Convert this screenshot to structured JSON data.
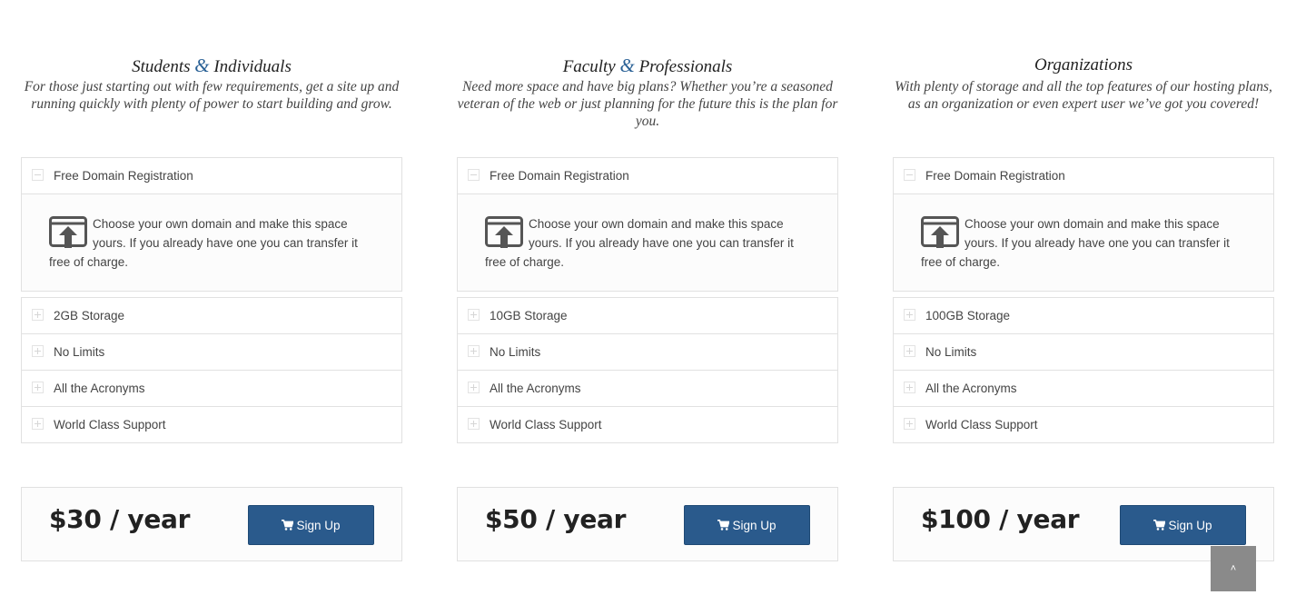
{
  "plans": [
    {
      "title_a": "Students",
      "amp": "&",
      "title_b": "Individuals",
      "description": "For those just starting out with few requirements, get a site up and running quickly with plenty of power to start building and grow.",
      "domain_feature": {
        "label": "Free Domain Registration",
        "body": "Choose your own domain and make this space yours. If you already have one you can transfer it free of charge.",
        "icon": "upload-window-icon"
      },
      "features": [
        "2GB Storage",
        "No Limits",
        "All the Acronyms",
        "World Class Support"
      ],
      "price": "$30 / year",
      "signup_label": "Sign Up"
    },
    {
      "title_a": "Faculty",
      "amp": "&",
      "title_b": "Professionals",
      "description": "Need more space and have big plans? Whether you’re a seasoned veteran of the web or just planning for the future this is the plan for you.",
      "domain_feature": {
        "label": "Free Domain Registration",
        "body": "Choose your own domain and make this space yours. If you already have one you can transfer it free of charge.",
        "icon": "upload-window-icon"
      },
      "features": [
        "10GB Storage",
        "No Limits",
        "All the Acronyms",
        "World Class Support"
      ],
      "price": "$50 / year",
      "signup_label": "Sign Up"
    },
    {
      "title_a": "Organizations",
      "amp": "",
      "title_b": "",
      "description": "With plenty of storage and all the top features of our hosting plans, as an organization or even expert user we’ve got you covered!",
      "domain_feature": {
        "label": "Free Domain Registration",
        "body": "Choose your own domain and make this space yours. If you already have one you can transfer it free of charge.",
        "icon": "upload-window-icon"
      },
      "features": [
        "100GB Storage",
        "No Limits",
        "All the Acronyms",
        "World Class Support"
      ],
      "price": "$100 / year",
      "signup_label": "Sign Up"
    }
  ],
  "colors": {
    "accent": "#2a5a8c",
    "ampersand": "#2a6196",
    "scroll_button": "#8a8a8a"
  },
  "scroll_top": {
    "icon": "chevron-up-icon",
    "glyph": "˄"
  }
}
